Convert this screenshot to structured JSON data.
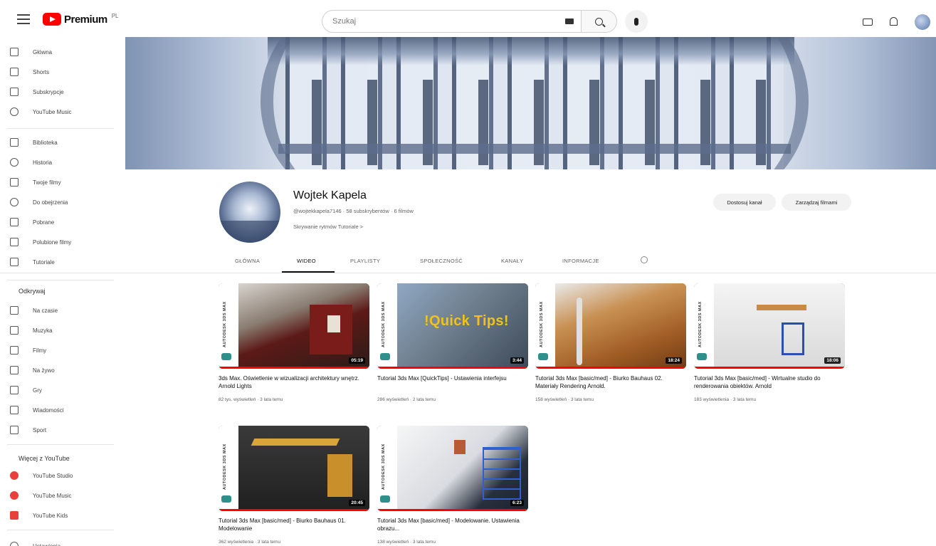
{
  "header": {
    "logo_text": "Premium",
    "logo_sup": "PL",
    "search_placeholder": "Szukaj"
  },
  "sidebar": {
    "main": [
      {
        "label": "Główna",
        "icon": "home-icon"
      },
      {
        "label": "Shorts",
        "icon": "shorts-icon"
      },
      {
        "label": "Subskrypcje",
        "icon": "subscriptions-icon"
      },
      {
        "label": "YouTube Music",
        "icon": "music-icon"
      }
    ],
    "you": [
      {
        "label": "Biblioteka",
        "icon": "library-icon"
      },
      {
        "label": "Historia",
        "icon": "history-icon"
      },
      {
        "label": "Twoje filmy",
        "icon": "your-videos-icon"
      },
      {
        "label": "Do obejrzenia",
        "icon": "watch-later-icon"
      },
      {
        "label": "Pobrane",
        "icon": "download-icon"
      },
      {
        "label": "Polubione filmy",
        "icon": "liked-icon"
      },
      {
        "label": "Tutoriale",
        "icon": "playlist-icon"
      }
    ],
    "explore_title": "Odkrywaj",
    "explore": [
      {
        "label": "Na czasie",
        "icon": "trending-icon"
      },
      {
        "label": "Muzyka",
        "icon": "music-note-icon"
      },
      {
        "label": "Filmy",
        "icon": "movies-icon"
      },
      {
        "label": "Na żywo",
        "icon": "live-icon"
      },
      {
        "label": "Gry",
        "icon": "gaming-icon"
      },
      {
        "label": "Wiadomości",
        "icon": "news-icon"
      },
      {
        "label": "Sport",
        "icon": "sport-icon"
      }
    ],
    "more_title": "Więcej z YouTube",
    "more": [
      {
        "label": "YouTube Studio",
        "icon": "studio-icon"
      },
      {
        "label": "YouTube Music",
        "icon": "yt-music-icon"
      },
      {
        "label": "YouTube Kids",
        "icon": "yt-kids-icon"
      }
    ],
    "last_item": "Ustawienia"
  },
  "channel": {
    "name": "Wojtek Kapela",
    "meta": "@wojtekkapela7146 · 58 subskrybentów · 6 filmów",
    "description": "Skrywanie rytmów Tutoriale  >",
    "customize_label": "Dostosuj kanał",
    "manage_label": "Zarządzaj filmami"
  },
  "tabs": [
    {
      "label": "GŁÓWNA"
    },
    {
      "label": "WIDEO"
    },
    {
      "label": "PLAYLISTY"
    },
    {
      "label": "SPOŁECZNOŚĆ"
    },
    {
      "label": "KANAŁY"
    },
    {
      "label": "INFORMACJE"
    }
  ],
  "strip_text": "AUTODESK 3DS MAX",
  "quick_tips_text": "!Quick Tips!",
  "videos": [
    {
      "title": "3ds Max. Oświetlenie w wizualizacji architektury wnętrz. Arnold Lights",
      "meta": "82 tys. wyświetleń · 3 lata temu",
      "duration": "05:19"
    },
    {
      "title": "Tutorial 3ds Max [QuickTips] - Ustawienia interfejsu",
      "meta": "286 wyświetleń · 2 lata temu",
      "duration": "3:44"
    },
    {
      "title": "Tutorial 3ds Max [basic/med] - Biurko Bauhaus 02. Materiały Rendering Arnold.",
      "meta": "158 wyświetleń · 3 lata temu",
      "duration": "18:24"
    },
    {
      "title": "Tutorial 3ds Max [basic/med] - Wirtualne studio do renderowania obiektów. Arnold",
      "meta": "183 wyświetlenia · 3 lata temu",
      "duration": "18:06"
    },
    {
      "title": "Tutorial 3ds Max [basic/med] - Biurko Bauhaus 01. Modelowanie",
      "meta": "362 wyświetlenia · 3 lata temu",
      "duration": "20:45"
    },
    {
      "title": "Tutorial 3ds Max [basic/med] - Modelowanie. Ustawienia obrazu...",
      "meta": "138 wyświetleń · 3 lata temu",
      "duration": "6:23"
    }
  ],
  "colors": {
    "accent_red": "#ff0000",
    "quick_tips_yellow": "#f0c21b"
  }
}
